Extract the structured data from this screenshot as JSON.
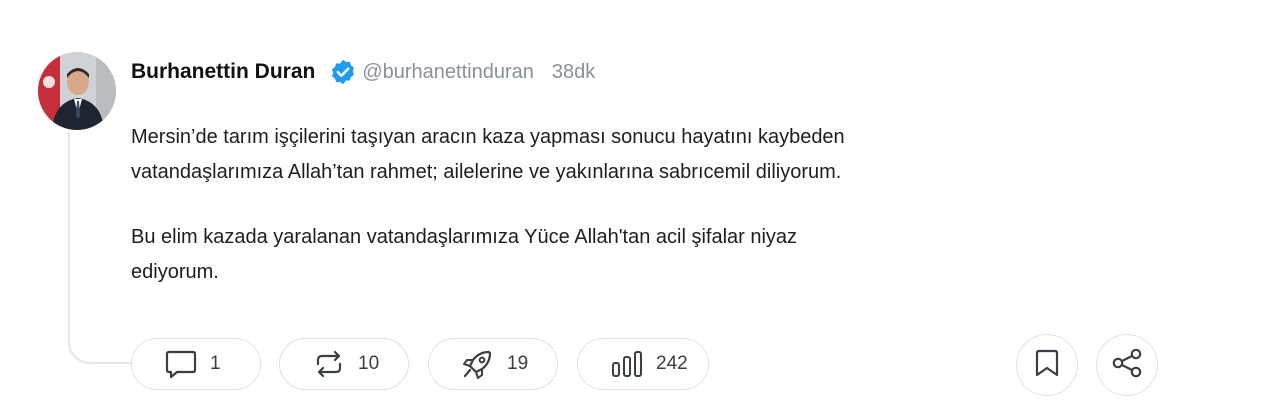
{
  "post": {
    "author_name": "Burhanettin Duran",
    "handle": "@burhanettinduran",
    "timestamp": "38dk",
    "verified": true,
    "paragraphs": [
      "Mersin’de tarım işçilerini taşıyan aracın kaza yapması sonucu hayatını kaybeden\nvatandaşlarımıza Allah’tan rahmet; ailelerine ve yakınlarına sabrıcemil diliyorum.",
      "Bu elim kazada yaralanan vatandaşlarımıza Yüce Allah'tan acil şifalar niyaz\nediyorum."
    ]
  },
  "actions": {
    "replies": {
      "icon": "comment-icon",
      "count": "1"
    },
    "reposts": {
      "icon": "repost-icon",
      "count": "10"
    },
    "boosts": {
      "icon": "rocket-icon",
      "count": "19"
    },
    "views": {
      "icon": "bar-chart-icon",
      "count": "242"
    },
    "bookmark": {
      "icon": "bookmark-icon"
    },
    "share": {
      "icon": "share-icon"
    }
  },
  "colors": {
    "verified_badge": "#1d9bf0",
    "muted_text": "#8a9099",
    "border": "#dfe2e6",
    "thread_line": "#e3e5e8"
  }
}
